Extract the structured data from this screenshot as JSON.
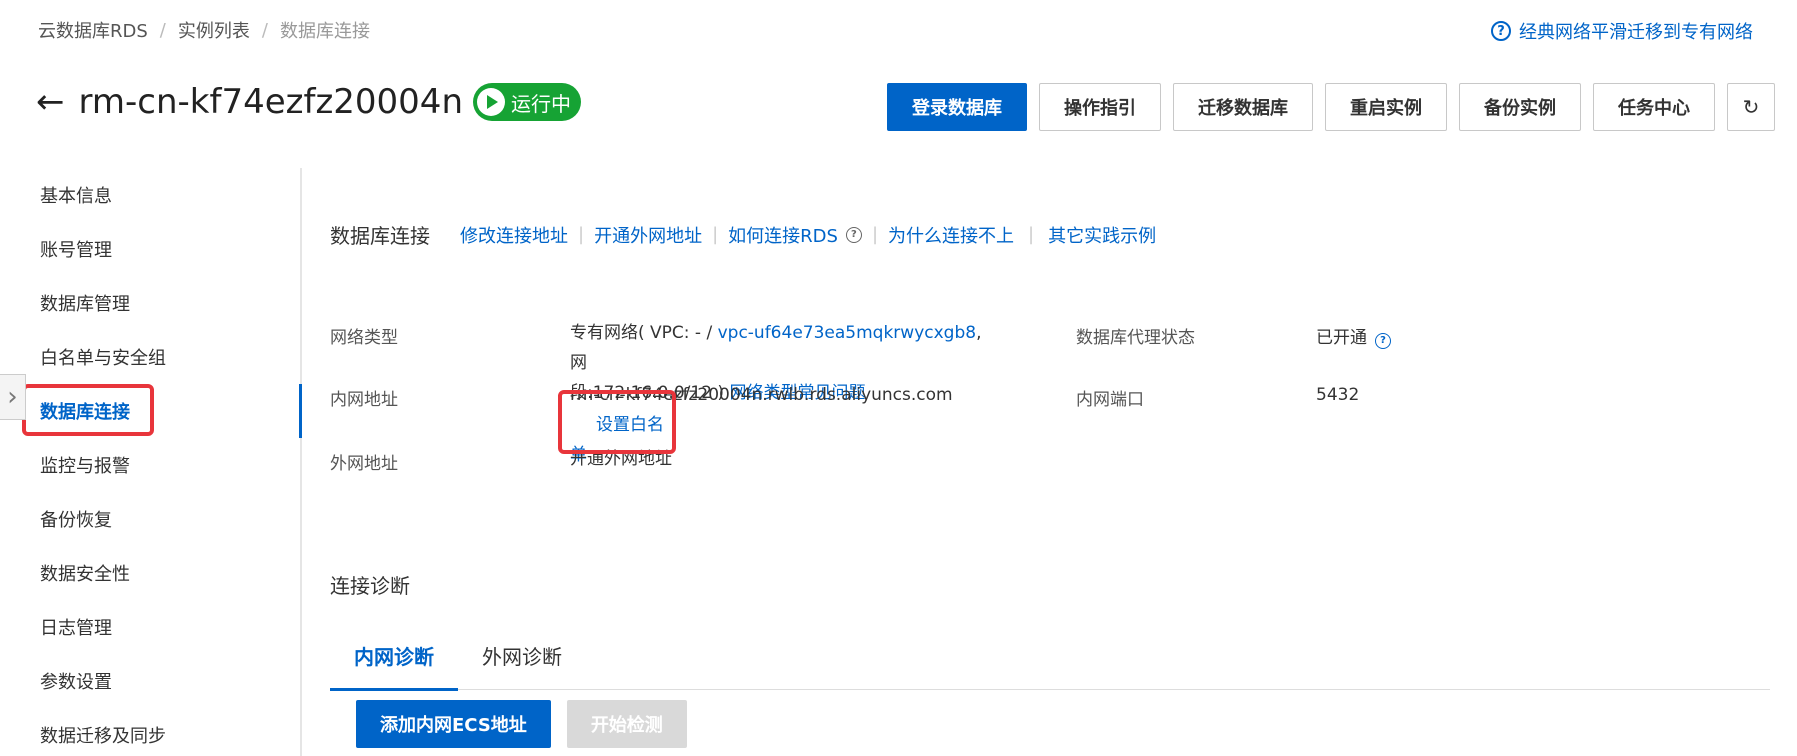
{
  "breadcrumb": {
    "items": [
      "云数据库RDS",
      "实例列表",
      "数据库连接"
    ],
    "separator": "/"
  },
  "top_help": {
    "icon": "help-circle-icon",
    "label": "经典网络平滑迁移到专有网络"
  },
  "header": {
    "instance_id": "rm-cn-kf74ezfz20004n",
    "status": "运行中"
  },
  "actions": [
    "登录数据库",
    "操作指引",
    "迁移数据库",
    "重启实例",
    "备份实例",
    "任务中心"
  ],
  "refresh_icon": "↻",
  "sidebar": {
    "items": [
      "基本信息",
      "账号管理",
      "数据库管理",
      "白名单与安全组",
      "数据库连接",
      "监控与报警",
      "备份恢复",
      "数据安全性",
      "日志管理",
      "参数设置",
      "数据迁移及同步"
    ],
    "active_index": 4
  },
  "connection": {
    "title": "数据库连接",
    "links": [
      "修改连接地址",
      "开通外网地址",
      "如何连接RDS",
      "为什么连接不上",
      "其它实践示例"
    ]
  },
  "info": {
    "network_type_label": "网络类型",
    "network_type_prefix": "专有网络( VPC: - / ",
    "vpc_id": "vpc-uf64e73ea5mqkrwycxgb8",
    "network_type_mid": ", 网",
    "network_type_line2": "段:172.16.0.0/12 ) ",
    "network_faq": "网络类型常见问题",
    "proxy_label": "数据库代理状态",
    "proxy_value": "已开通",
    "intranet_label": "内网地址",
    "intranet_value": "rm-cn-kf74ezfz20004n.rwlb.rds.aliyuncs.com",
    "set_whitelist": "设置白名",
    "set_whitelist_wrap": "单",
    "intranet_port_label": "内网端口",
    "intranet_port_value": "5432",
    "public_label": "外网地址",
    "public_link": "开通外网地址"
  },
  "diagnosis": {
    "title": "连接诊断",
    "tabs": [
      "内网诊断",
      "外网诊断"
    ],
    "active_tab": 0,
    "add_button": "添加内网ECS地址",
    "start_button": "开始检测"
  },
  "colors": {
    "primary": "#0064c8",
    "running": "#16a334",
    "highlight": "#e8353b"
  }
}
